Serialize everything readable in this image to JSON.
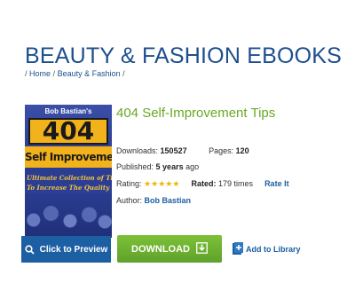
{
  "header": {
    "title": "BEAUTY & FASHION EBOOKS",
    "breadcrumb": {
      "sep_start": "/",
      "home": "Home",
      "sep1": "/",
      "category": "Beauty & Fashion",
      "sep_end": "/"
    }
  },
  "cover": {
    "author": "Bob Bastian's",
    "number": "404",
    "subtitle": "Self Improvement Tips",
    "tagline_1": "Ultimate Collection of Tips & Tactics",
    "tagline_2": "To Increase The Quality of Your Life"
  },
  "preview": {
    "label": "Click to Preview",
    "icon": "magnifier-icon"
  },
  "book": {
    "title": "404 Self-Improvement Tips",
    "downloads_label": "Downloads:",
    "downloads_value": "150527",
    "pages_label": "Pages:",
    "pages_value": "120",
    "published_label": "Published:",
    "published_value": "5 years",
    "published_suffix": "ago",
    "rating_label": "Rating:",
    "rating_stars": 5,
    "rated_label": "Rated:",
    "rated_value": "179 times",
    "rate_it": "Rate It",
    "author_label": "Author:",
    "author_value": "Bob Bastian"
  },
  "actions": {
    "download_label": "DOWNLOAD",
    "download_icon": "download-icon",
    "add_library_label": "Add to Library",
    "add_library_icon": "add-library-icon"
  },
  "colors": {
    "title_blue": "#1d4f8f",
    "link_blue": "#1d5fa3",
    "book_title_green": "#6aa823",
    "download_green": "#6cb02f",
    "star_gold": "#f0b400"
  }
}
